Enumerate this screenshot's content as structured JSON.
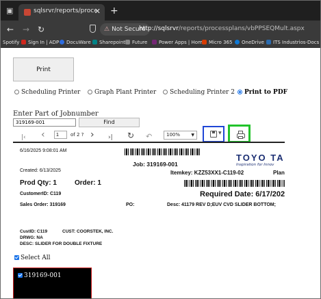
{
  "browser": {
    "tab_title": "sqlsrvr/reports/processplans/vbPPSE",
    "new_tab": "+",
    "not_secure": "Not Secure",
    "url_host": "http://sqlsrvr",
    "url_path": "/reports/processplans/vbPPSEQMult.aspx"
  },
  "bookmarks": [
    {
      "label": "Spotify",
      "color": "#1db954"
    },
    {
      "label": "Sign In | ADP",
      "color": "#d0271d"
    },
    {
      "label": "DocuWare",
      "color": "#2d6cdf"
    },
    {
      "label": "Sharepoint",
      "color": "#038387"
    },
    {
      "label": "Future",
      "color": "#888888"
    },
    {
      "label": "Power Apps | Home",
      "color": "#742774"
    },
    {
      "label": "Micro 365",
      "color": "#d83b01"
    },
    {
      "label": "OneDrive",
      "color": "#0f78d4"
    },
    {
      "label": "ITS Industrios-Docs",
      "color": "#2b6cb0"
    }
  ],
  "controls": {
    "print_button": "Print",
    "printers": [
      {
        "label": "Scheduling Printer",
        "selected": false
      },
      {
        "label": "Graph Plant Printer",
        "selected": false
      },
      {
        "label": "Scheduling Printer 2",
        "selected": false
      },
      {
        "label": "Print to PDF",
        "selected": true
      }
    ],
    "job_label": "Enter Part of Jobnumber",
    "job_value": "319169-001",
    "find_button": "Find"
  },
  "viewer": {
    "page_number": "1",
    "page_of": "of 2 ?",
    "zoom": "100%",
    "first_icon": "first-page-icon",
    "prev_icon": "prev-page-icon",
    "next_icon": "next-page-icon",
    "last_icon": "last-page-icon",
    "refresh_icon": "refresh-icon",
    "back_icon": "back-icon",
    "save_icon": "save-icon",
    "print_icon": "print-icon"
  },
  "report": {
    "datetime": "6/16/2025 9:08:01 AM",
    "job": "Job: 319169-001",
    "logo": "TOYO TANS",
    "logo_sub": "Inspiration for Innov",
    "created": "Created: 6/13/2025",
    "itemkey": "Itemkey: KZZ53XX1-C119-02",
    "plan": "Plan",
    "prod_qty": "Prod Qty: 1",
    "order": "Order: 1",
    "customer_id": "CustomerID: C119",
    "required_date": "Required Date: 6/17/2025",
    "sales_order": "Sales Order: 319169",
    "po": "PO:",
    "desc": "Desc: 41179 REV D;EUV CVD SLIDER BOTTOM;",
    "cust_id": "CustID: C119",
    "cust_name": "CUST: COORSTEK, INC.",
    "drwg": "DRWG: NA",
    "desc2": "DESC: SLIDER FOR DOUBLE FIXTURE"
  },
  "bottom": {
    "select_all": "Select All",
    "job_item": "319169-001"
  }
}
